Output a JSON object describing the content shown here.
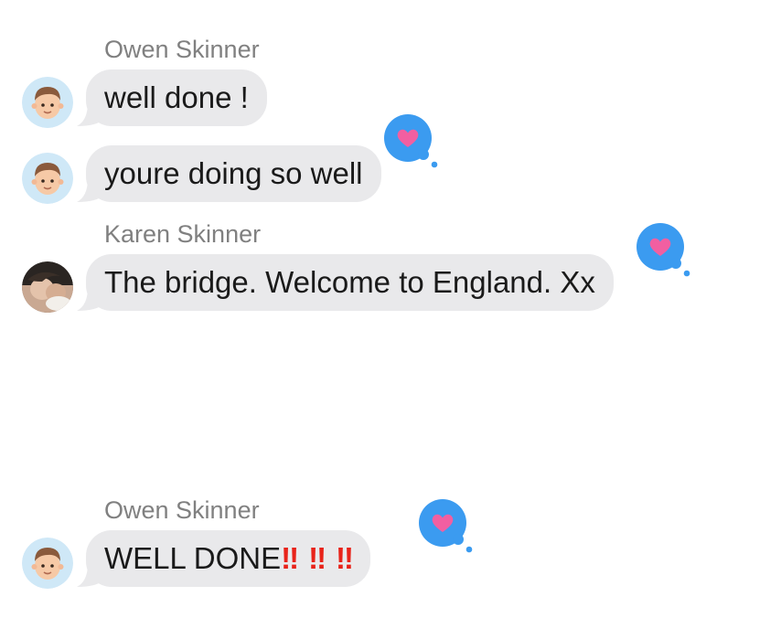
{
  "messages": [
    {
      "sender": "Owen Skinner",
      "text": "well done !",
      "avatar": "memoji-boy-icon",
      "reaction": null
    },
    {
      "sender": "",
      "text": "youre doing so well",
      "avatar": "memoji-boy-icon",
      "reaction": "heart"
    },
    {
      "sender": "Karen Skinner",
      "text": "The bridge. Welcome to England. Xx",
      "avatar": "photo-avatar-icon",
      "reaction": "heart"
    },
    {
      "sender": "Owen Skinner",
      "text": "WELL DONE",
      "emphasis": [
        "‼",
        "‼",
        "‼"
      ],
      "avatar": "memoji-boy-icon",
      "reaction": "heart"
    }
  ],
  "colors": {
    "bubble_bg": "#e9e9eb",
    "sender_text": "#808080",
    "tapback_bg": "#3b9bf0",
    "heart": "#f25fa1",
    "exclamation": "#e8231a"
  },
  "icons": {
    "reaction": "heart-tapback-icon"
  }
}
